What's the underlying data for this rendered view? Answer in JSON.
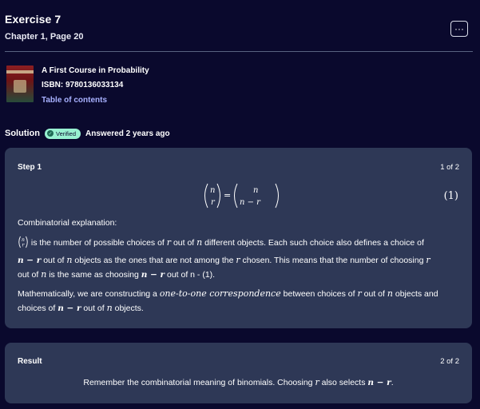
{
  "exercise": {
    "title": "Exercise 7",
    "subtitle": "Chapter 1, Page 20",
    "more_label": "···"
  },
  "book": {
    "cover_icon": "book-cover-image",
    "title": "A First Course in Probability",
    "isbn": "ISBN: 9780136033134",
    "toc_link": "Table of contents"
  },
  "solution": {
    "label": "Solution",
    "badge": "Verified",
    "badge_icon": "checkmark-icon",
    "answered": "Answered 2 years ago"
  },
  "step": {
    "title": "Step 1",
    "count": "1 of 2",
    "equation_number": "(1)",
    "intro": "Combinatorial explanation:",
    "p1_a": " is the number of possible choices of ",
    "p1_r1": "r",
    "p1_b": " out of ",
    "p1_n1": "n",
    "p1_c": " different objects. Each such choice also defines a choice of",
    "p2_nr": "n − r",
    "p2_a": " out of ",
    "p2_n": "n",
    "p2_b": " objects as the ones that are not among the ",
    "p2_r": "r",
    "p2_c": " chosen. This means that the number of choosing ",
    "p2_r2": "r",
    "p3_a": "out of ",
    "p3_n": "n",
    "p3_b": " is the same as choosing ",
    "p3_nr": "n − r",
    "p3_c": " out of n - (1).",
    "m1_a": "Mathematically, we are constructing a ",
    "m1_em": "one-to-one correspondence",
    "m1_b": " between choices of ",
    "m1_r": "r",
    "m1_c": " out of ",
    "m1_n": "n",
    "m1_d": " objects and",
    "m2_a": "choices of ",
    "m2_nr": "n − r",
    "m2_b": " out of ",
    "m2_n": "n",
    "m2_c": " objects."
  },
  "result": {
    "title": "Result",
    "count": "2 of 2",
    "text_a": "Remember the combinatorial meaning of binomials. Choosing ",
    "text_r": "r",
    "text_b": " also selects ",
    "text_nr": "n − r",
    "text_c": "."
  }
}
